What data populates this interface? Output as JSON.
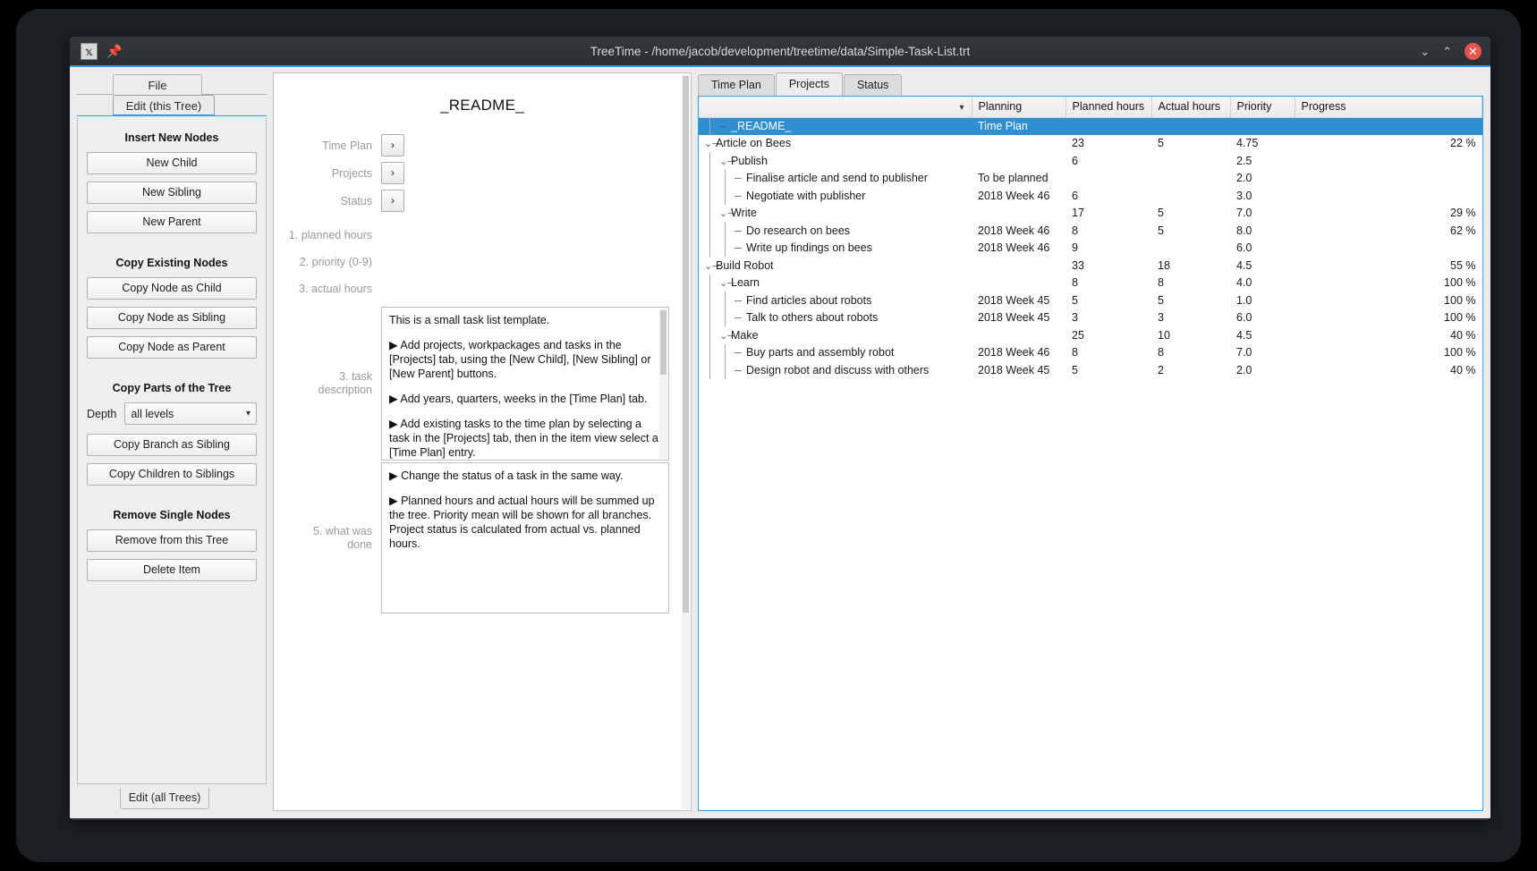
{
  "window": {
    "title": "TreeTime - /home/jacob/development/treetime/data/Simple-Task-List.trt",
    "app_icon": "application-icon",
    "pin_icon": "pin-icon",
    "minimize": "⌄",
    "maximize": "⌃",
    "close": "✕"
  },
  "left_panel": {
    "tab_file": "File",
    "tab_edit_this_tree": "Edit (this Tree)",
    "tab_edit_all_trees": "Edit (all Trees)",
    "groups": [
      {
        "title": "Insert New Nodes",
        "buttons": [
          "New Child",
          "New Sibling",
          "New Parent"
        ]
      },
      {
        "title": "Copy Existing Nodes",
        "buttons": [
          "Copy Node as Child",
          "Copy Node as Sibling",
          "Copy Node as Parent"
        ]
      },
      {
        "title": "Copy Parts of the Tree",
        "depth_label": "Depth",
        "depth_value": "all levels",
        "buttons": [
          "Copy Branch as Sibling",
          "Copy Children to Siblings"
        ]
      },
      {
        "title": "Remove Single Nodes",
        "buttons": [
          "Remove from this Tree",
          "Delete Item"
        ]
      }
    ]
  },
  "item_view": {
    "title": "_README_",
    "links": [
      {
        "label": "Time Plan",
        "button": "›"
      },
      {
        "label": "Projects",
        "button": "›"
      },
      {
        "label": "Status",
        "button": "›"
      }
    ],
    "numeric_fields": [
      {
        "label": "1. planned hours",
        "value": ""
      },
      {
        "label": "2. priority (0-9)",
        "value": ""
      },
      {
        "label": "3. actual hours",
        "value": ""
      }
    ],
    "description_label": "3. task description",
    "description_paragraphs": [
      "This is a small task list template.",
      "▶    Add projects, workpackages and tasks in the [Projects] tab, using the [New Child], [New Sibling] or [New Parent] buttons.",
      "▶    Add years, quarters, weeks in the [Time Plan] tab.",
      "▶    Add existing tasks to the time plan by selecting a task in the [Projects] tab, then in the item view select a [Time Plan] entry."
    ],
    "done_label": "5. what was done",
    "done_paragraphs": [
      "▶    Change the status of a task in the same way.",
      "▶    Planned hours and actual hours will be summed up the tree. Priority mean will be shown for all branches. Project status is calculated from actual vs. planned hours."
    ]
  },
  "right_panel": {
    "tabs": [
      {
        "label": "Time Plan",
        "active": false
      },
      {
        "label": "Projects",
        "active": true
      },
      {
        "label": "Status",
        "active": false
      }
    ],
    "columns": [
      "",
      "Planning",
      "Planned hours",
      "Actual hours",
      "Priority",
      "Progress"
    ],
    "sort_chevron_icon": "chevron-down-icon",
    "selection_color": "#2f8fd0",
    "rows": [
      {
        "name": "_README_",
        "indent": 1,
        "twig": "─",
        "selected": true,
        "planning": "Time Plan",
        "planned": "",
        "actual": "",
        "priority": "",
        "progress": ""
      },
      {
        "name": "Article on Bees",
        "indent": 0,
        "twig": "⌄─",
        "selected": false,
        "planning": "",
        "planned": "23",
        "actual": "5",
        "priority": "4.75",
        "progress": "22 %"
      },
      {
        "name": "Publish",
        "indent": 1,
        "twig": "⌄─",
        "selected": false,
        "planning": "",
        "planned": "6",
        "actual": "",
        "priority": "2.5",
        "progress": ""
      },
      {
        "name": "Finalise article and send to publisher",
        "indent": 2,
        "twig": "─",
        "selected": false,
        "planning": "To be planned",
        "planned": "",
        "actual": "",
        "priority": "2.0",
        "progress": ""
      },
      {
        "name": "Negotiate with publisher",
        "indent": 2,
        "twig": "─",
        "selected": false,
        "planning": "2018 Week 46",
        "planned": "6",
        "actual": "",
        "priority": "3.0",
        "progress": ""
      },
      {
        "name": "Write",
        "indent": 1,
        "twig": "⌄─",
        "selected": false,
        "planning": "",
        "planned": "17",
        "actual": "5",
        "priority": "7.0",
        "progress": "29 %"
      },
      {
        "name": "Do research on bees",
        "indent": 2,
        "twig": "─",
        "selected": false,
        "planning": "2018 Week 46",
        "planned": "8",
        "actual": "5",
        "priority": "8.0",
        "progress": "62 %"
      },
      {
        "name": "Write up findings on bees",
        "indent": 2,
        "twig": "─",
        "selected": false,
        "planning": "2018 Week 46",
        "planned": "9",
        "actual": "",
        "priority": "6.0",
        "progress": ""
      },
      {
        "name": "Build Robot",
        "indent": 0,
        "twig": "⌄─",
        "selected": false,
        "planning": "",
        "planned": "33",
        "actual": "18",
        "priority": "4.5",
        "progress": "55 %"
      },
      {
        "name": "Learn",
        "indent": 1,
        "twig": "⌄─",
        "selected": false,
        "planning": "",
        "planned": "8",
        "actual": "8",
        "priority": "4.0",
        "progress": "100 %"
      },
      {
        "name": "Find articles about robots",
        "indent": 2,
        "twig": "─",
        "selected": false,
        "planning": "2018 Week 45",
        "planned": "5",
        "actual": "5",
        "priority": "1.0",
        "progress": "100 %"
      },
      {
        "name": "Talk to others about robots",
        "indent": 2,
        "twig": "─",
        "selected": false,
        "planning": "2018 Week 45",
        "planned": "3",
        "actual": "3",
        "priority": "6.0",
        "progress": "100 %"
      },
      {
        "name": "Make",
        "indent": 1,
        "twig": "⌄─",
        "selected": false,
        "planning": "",
        "planned": "25",
        "actual": "10",
        "priority": "4.5",
        "progress": "40 %"
      },
      {
        "name": "Buy parts and assembly robot",
        "indent": 2,
        "twig": "─",
        "selected": false,
        "planning": "2018 Week 46",
        "planned": "8",
        "actual": "8",
        "priority": "7.0",
        "progress": "100 %"
      },
      {
        "name": "Design robot and discuss with others",
        "indent": 2,
        "twig": "─",
        "selected": false,
        "planning": "2018 Week 45",
        "planned": "5",
        "actual": "2",
        "priority": "2.0",
        "progress": "40 %"
      }
    ]
  }
}
